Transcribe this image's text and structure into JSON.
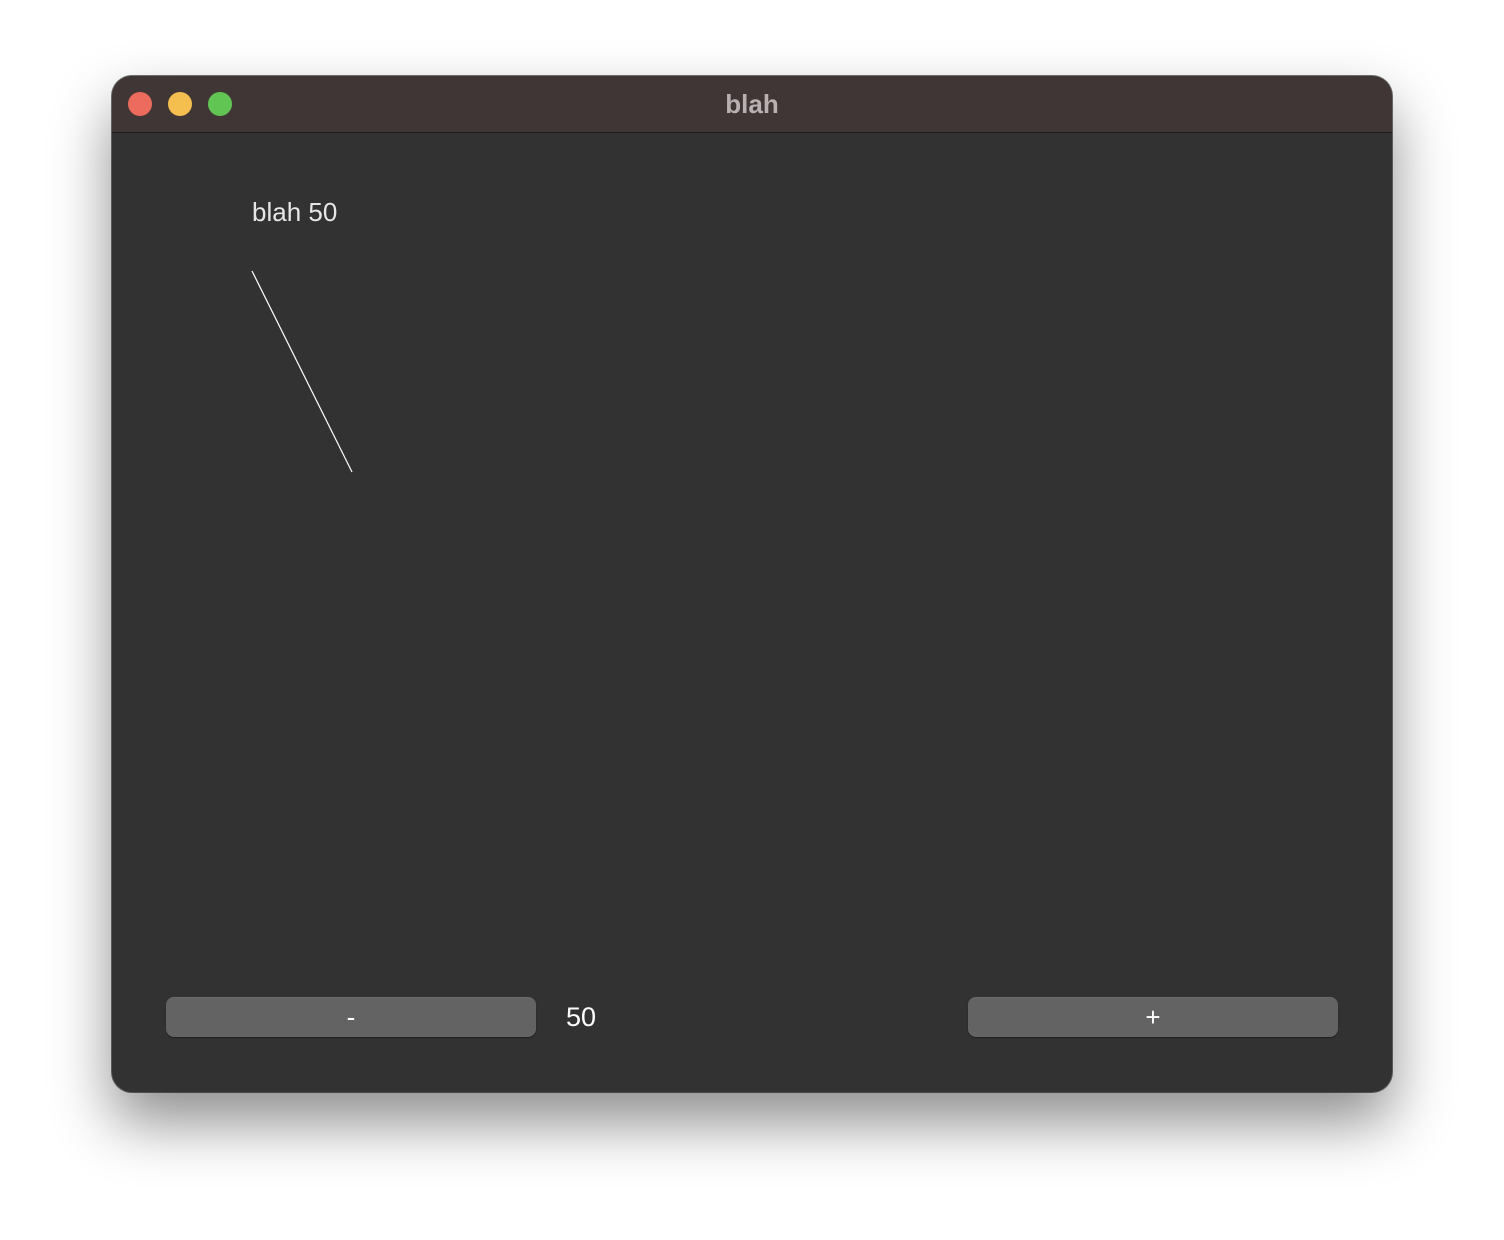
{
  "window": {
    "title": "blah",
    "controls": {
      "close": "close-button",
      "minimize": "minimize-button",
      "zoom": "zoom-button"
    }
  },
  "content": {
    "heading": "blah 50",
    "value": "50",
    "minus_label": "-",
    "plus_label": "+"
  },
  "colors": {
    "window_bg": "#323232",
    "titlebar_bg": "#403636",
    "button_bg": "#636363",
    "close": "#ec6a5e",
    "minimize": "#f4bf4f",
    "zoom": "#61c554"
  }
}
